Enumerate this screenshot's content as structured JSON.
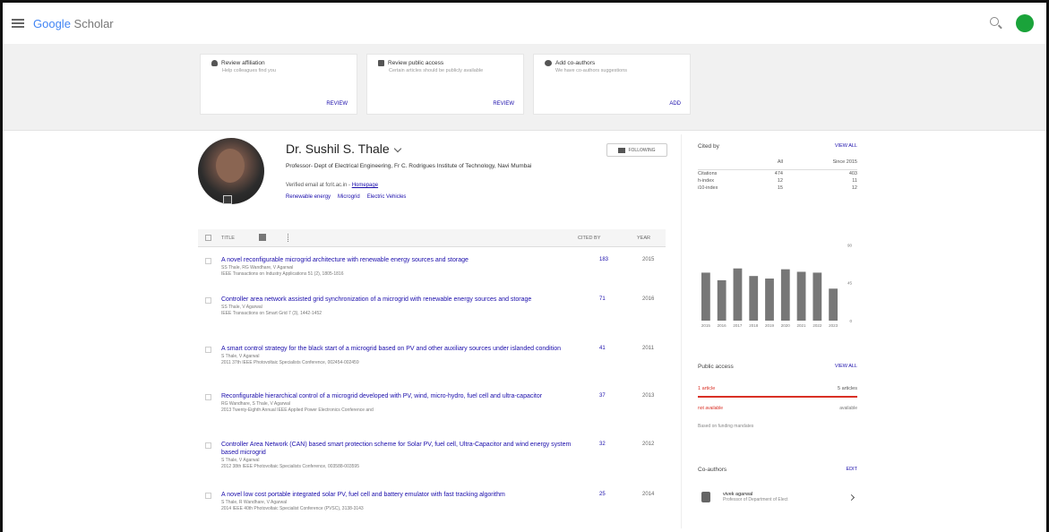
{
  "header": {
    "logo_google": "Google",
    "logo_scholar": "Scholar"
  },
  "banner": {
    "cards": [
      {
        "title": "Review affiliation",
        "sub": "Help colleagues find you",
        "action": "REVIEW",
        "icon": "person-icon"
      },
      {
        "title": "Review public access",
        "sub": "Certain articles should be publicly available",
        "action": "REVIEW",
        "icon": "lock-icon"
      },
      {
        "title": "Add co-authors",
        "sub": "We have co-authors suggestions",
        "action": "ADD",
        "icon": "people-add-icon"
      }
    ]
  },
  "profile": {
    "name": "Dr. Sushil S. Thale",
    "affiliation": "Professor- Dept of Electrical Engineering, Fr C. Rodrigues Institute of Technology, Navi Mumbai",
    "verified_prefix": "Verified email at fcrit.ac.in - ",
    "homepage": "Homepage",
    "interests": [
      "Renewable energy",
      "Microgrid",
      "Electric Vehicles"
    ],
    "follow_label": "FOLLOWING"
  },
  "table": {
    "col_title": "TITLE",
    "col_cited": "CITED BY",
    "col_year": "YEAR",
    "rows": [
      {
        "title": "A novel reconfigurable microgrid architecture with renewable energy sources and storage",
        "authors": "SS Thale, RG Wandhare, V Agarwal",
        "venue": "IEEE Transactions on Industry Applications 51 (2), 1805-1816",
        "cited": "183",
        "year": "2015"
      },
      {
        "title": "Controller area network assisted grid synchronization of a microgrid with renewable energy sources and storage",
        "authors": "SS Thale, V Agarwal",
        "venue": "IEEE Transactions on Smart Grid 7 (3), 1442-1452",
        "cited": "71",
        "year": "2016"
      },
      {
        "title": "A smart control strategy for the black start of a microgrid based on PV and other auxiliary sources under islanded condition",
        "authors": "S Thale, V Agarwal",
        "venue": "2011 37th IEEE Photovoltaic Specialists Conference, 002454-002459",
        "cited": "41",
        "year": "2011"
      },
      {
        "title": "Reconfigurable hierarchical control of a microgrid developed with PV, wind, micro-hydro, fuel cell and ultra-capacitor",
        "authors": "RG Wandhare, S Thale, V Agarwal",
        "venue": "2013 Twenty-Eighth Annual IEEE Applied Power Electronics Conference and",
        "cited": "37",
        "year": "2013"
      },
      {
        "title": "Controller Area Network (CAN) based smart protection scheme for Solar PV, fuel cell, Ultra-Capacitor and wind energy system based microgrid",
        "authors": "S Thale, V Agarwal",
        "venue": "2012 38th IEEE Photovoltaic Specialists Conference, 003588-003595",
        "cited": "32",
        "year": "2012"
      },
      {
        "title": "A novel low cost portable integrated solar PV, fuel cell and battery emulator with fast tracking algorithm",
        "authors": "S Thale, R Wandhare, V Agarwal",
        "venue": "2014 IEEE 40th Photovoltaic Specialist Conference (PVSC), 3138-3143",
        "cited": "25",
        "year": "2014"
      }
    ]
  },
  "cited_by": {
    "title": "Cited by",
    "view_all": "VIEW ALL",
    "col_all": "All",
    "col_since": "Since 2015",
    "rows": [
      {
        "label": "Citations",
        "all": "474",
        "since": "403"
      },
      {
        "label": "h-index",
        "all": "12",
        "since": "11"
      },
      {
        "label": "i10-index",
        "all": "15",
        "since": "12"
      }
    ]
  },
  "chart_data": {
    "type": "bar",
    "categories": [
      "2015",
      "2016",
      "2017",
      "2018",
      "2019",
      "2020",
      "2021",
      "2022",
      "2023"
    ],
    "values": [
      57,
      48,
      62,
      53,
      50,
      61,
      58,
      57,
      38
    ],
    "ylim": [
      0,
      100
    ],
    "yticks": [
      "90",
      "45",
      "0"
    ],
    "bar_color": "#777777",
    "ylabel": "",
    "xlabel": ""
  },
  "public_access": {
    "title": "Public access",
    "view_all": "VIEW ALL",
    "left": "1 article",
    "right": "5 articles",
    "left2": "not available",
    "right2": "available",
    "note": "Based on funding mandates",
    "accent": "#d93025"
  },
  "coauthors": {
    "title": "Co-authors",
    "edit": "EDIT",
    "items": [
      {
        "name": "vivek agarwal",
        "affiliation": "Professor of Department of Elect"
      }
    ]
  }
}
